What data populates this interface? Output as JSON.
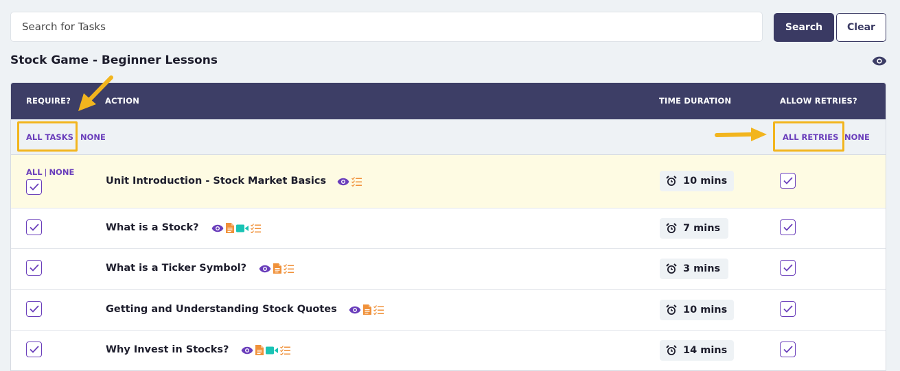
{
  "search": {
    "placeholder": "Search for Tasks",
    "value": ""
  },
  "buttons": {
    "search": "Search",
    "clear": "Clear"
  },
  "page_title": "Stock Game - Beginner Lessons",
  "table": {
    "headers": {
      "require": "REQUIRE?",
      "action": "ACTION",
      "time": "TIME DURATION",
      "retries": "ALLOW RETRIES?"
    },
    "subheader": {
      "all_tasks": "ALL TASKS",
      "none_tasks": "NONE",
      "all_retries": "ALL RETRIES",
      "none_retries": "NONE"
    },
    "row_links": {
      "all": "ALL",
      "sep": "|",
      "none": "NONE"
    },
    "rows": [
      {
        "title": "Unit Introduction - Stock Market Basics",
        "duration": "10 mins",
        "required": true,
        "retries": true,
        "icons": [
          "eye-icon",
          "checklist-icon"
        ]
      },
      {
        "title": "What is a Stock?",
        "duration": "7 mins",
        "required": true,
        "retries": true,
        "icons": [
          "eye-icon",
          "document-icon",
          "video-icon",
          "checklist-icon"
        ]
      },
      {
        "title": "What is a Ticker Symbol?",
        "duration": "3 mins",
        "required": true,
        "retries": true,
        "icons": [
          "eye-icon",
          "document-icon",
          "checklist-icon"
        ]
      },
      {
        "title": "Getting and Understanding Stock Quotes",
        "duration": "10 mins",
        "required": true,
        "retries": true,
        "icons": [
          "eye-icon",
          "document-icon",
          "checklist-icon"
        ]
      },
      {
        "title": "Why Invest in Stocks?",
        "duration": "14 mins",
        "required": true,
        "retries": true,
        "icons": [
          "eye-icon",
          "document-icon",
          "video-icon",
          "checklist-icon"
        ]
      }
    ]
  },
  "colors": {
    "header_bg": "#3d3e66",
    "accent": "#6a3ebb",
    "highlight": "#f2b51e",
    "first_row_bg": "#fefbe3",
    "icon_orange": "#f0913a",
    "icon_teal": "#19c3b4"
  }
}
